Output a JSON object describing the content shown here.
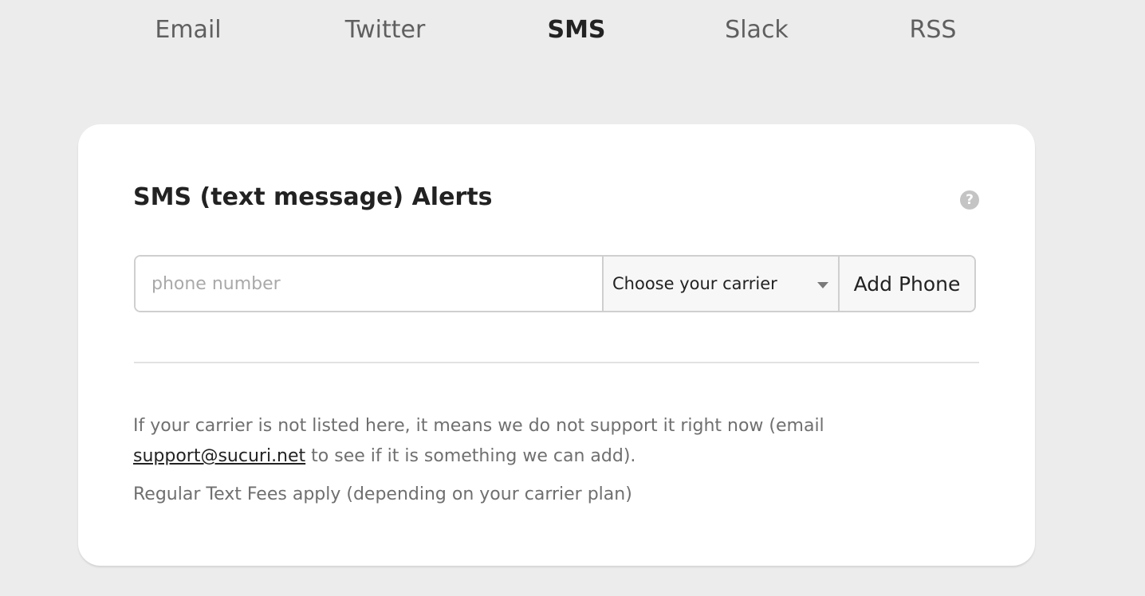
{
  "tabs": [
    {
      "label": "Email",
      "active": false
    },
    {
      "label": "Twitter",
      "active": false
    },
    {
      "label": "SMS",
      "active": true
    },
    {
      "label": "Slack",
      "active": false
    },
    {
      "label": "RSS",
      "active": false
    }
  ],
  "card": {
    "title": "SMS (text message) Alerts",
    "help_icon": "?",
    "phone": {
      "placeholder": "phone number",
      "value": ""
    },
    "carrier": {
      "selected": "Choose your carrier"
    },
    "add_button": "Add Phone",
    "note": {
      "text_before": "If your carrier is not listed here, it means we do not support it right now (email ",
      "email_link": "support@sucuri.net",
      "text_after": " to see if it is something we can add)."
    },
    "fees_text": "Regular Text Fees apply (depending on your carrier plan)"
  },
  "icons": {
    "help": "question-circle-icon",
    "dropdown": "caret-down-icon"
  },
  "colors": {
    "background": "#ececec",
    "card": "#ffffff",
    "active_tab": "#222222",
    "inactive_tab": "#5f5f5f",
    "muted_text": "#6f6f6f"
  }
}
